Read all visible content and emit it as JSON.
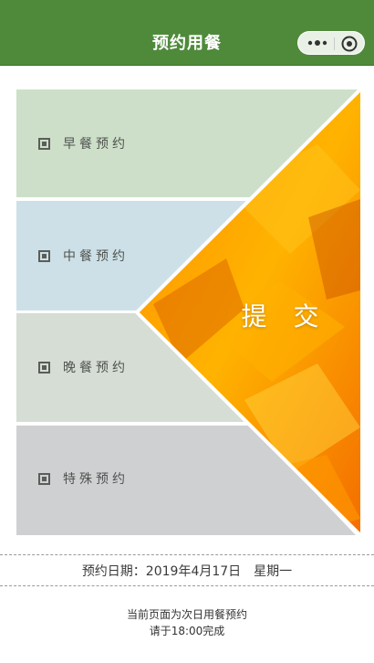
{
  "nav": {
    "title": "预约用餐"
  },
  "menu": {
    "items": [
      {
        "label": "早餐预约",
        "color": "#cddfc8"
      },
      {
        "label": "中餐预约",
        "color": "#cde0e7"
      },
      {
        "label": "晚餐预约",
        "color": "#d6ddd4"
      },
      {
        "label": "特殊预约",
        "color": "#cfd0d2"
      }
    ],
    "submit_label": "提 交",
    "photo_colors": [
      "#ff8c00",
      "#ffb300",
      "#f36d00"
    ]
  },
  "date": {
    "label": "预约日期：2019年4月17日",
    "weekday": "星期一"
  },
  "notes": {
    "line1": "当前页面为次日用餐预约",
    "line2": "请于18:00完成"
  },
  "colors": {
    "brand": "#4f8a3b",
    "gap": "#ffffff"
  }
}
